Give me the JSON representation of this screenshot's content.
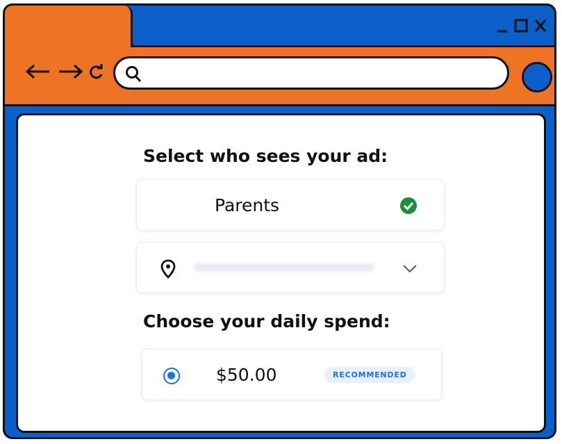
{
  "browser": {
    "window_controls": [
      "minimize-icon",
      "maximize-icon",
      "close-icon"
    ],
    "nav_icons": [
      "back-arrow-icon",
      "forward-arrow-icon",
      "reload-icon"
    ],
    "address_bar": {
      "value": "",
      "icon": "search-icon"
    },
    "profile_icon": "profile-circle-icon",
    "colors": {
      "frame": "#0a5fc9",
      "toolbar": "#ec7424",
      "outline": "#111111"
    }
  },
  "targeting": {
    "heading": "Select who sees your ad:",
    "audience": {
      "label": "Parents",
      "icon": "check-circle-icon",
      "check_color": "#1e8e3e"
    },
    "location": {
      "icon": "location-pin-icon",
      "dropdown_icon": "chevron-down-icon"
    }
  },
  "budget": {
    "heading": "Choose your daily spend:",
    "option": {
      "amount": "$50.00",
      "selected": true,
      "badge": "RECOMMENDED",
      "accent": "#1a73e8"
    }
  }
}
